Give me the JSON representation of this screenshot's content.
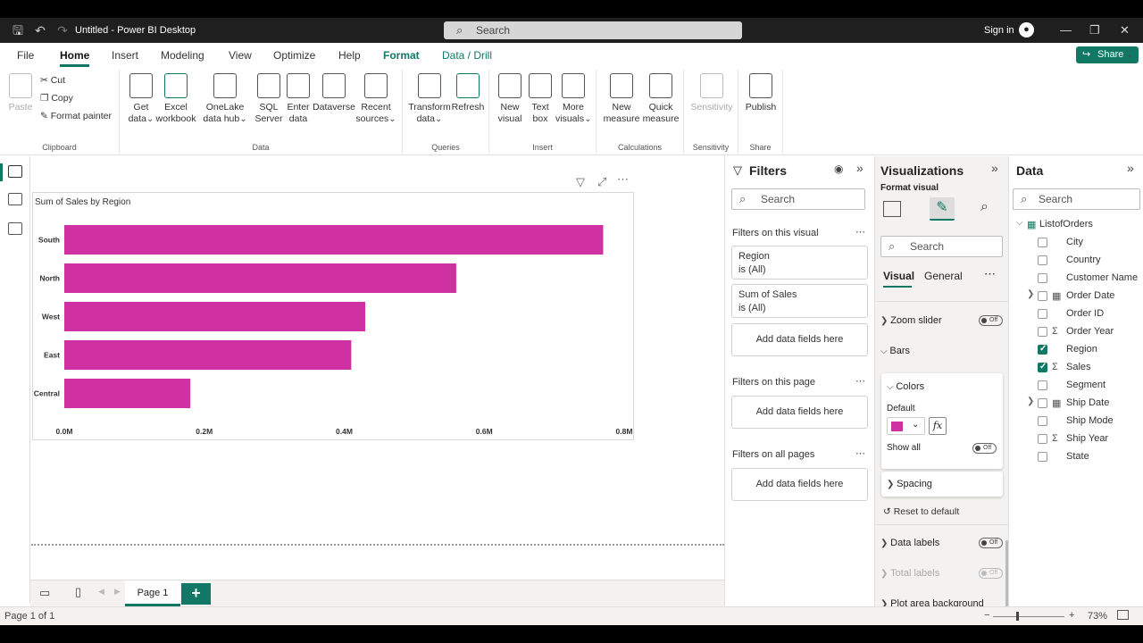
{
  "window": {
    "title": "Untitled - Power BI Desktop",
    "search_placeholder": "Search",
    "sign_in": "Sign in"
  },
  "tabs": [
    "File",
    "Home",
    "Insert",
    "Modeling",
    "View",
    "Optimize",
    "Help",
    "Format",
    "Data / Drill"
  ],
  "share_label": "Share",
  "ribbon": {
    "clipboard": {
      "paste": "Paste",
      "cut": "Cut",
      "copy": "Copy",
      "format_painter": "Format painter",
      "group": "Clipboard"
    },
    "data": {
      "get_data": "Get data",
      "excel": "Excel workbook",
      "onelake": "OneLake data hub",
      "sql": "SQL Server",
      "enter": "Enter data",
      "dataverse": "Dataverse",
      "recent": "Recent sources",
      "group": "Data"
    },
    "queries": {
      "transform": "Transform data",
      "refresh": "Refresh",
      "group": "Queries"
    },
    "insert": {
      "new_visual": "New visual",
      "text_box": "Text box",
      "more_visuals": "More visuals",
      "group": "Insert"
    },
    "calculations": {
      "new_measure": "New measure",
      "quick_measure": "Quick measure",
      "group": "Calculations"
    },
    "sensitivity": {
      "label": "Sensitivity",
      "group": "Sensitivity"
    },
    "share": {
      "publish": "Publish",
      "group": "Share"
    }
  },
  "chart_data": {
    "type": "bar",
    "title": "Sum of Sales by Region",
    "categories": [
      "South",
      "North",
      "West",
      "East",
      "Central"
    ],
    "values": [
      0.77,
      0.56,
      0.43,
      0.41,
      0.18
    ],
    "xlim": [
      0,
      0.8
    ],
    "x_ticks": [
      "0.0M",
      "0.2M",
      "0.4M",
      "0.6M",
      "0.8M"
    ],
    "bar_color": "#d031a2",
    "orientation": "horizontal"
  },
  "filters": {
    "title": "Filters",
    "search": "Search",
    "on_visual": "Filters on this visual",
    "cards": [
      {
        "field": "Region",
        "state": "is (All)"
      },
      {
        "field": "Sum of Sales",
        "state": "is (All)"
      }
    ],
    "add_fields": "Add data fields here",
    "on_page": "Filters on this page",
    "on_all_pages": "Filters on all pages"
  },
  "visualizations": {
    "title": "Visualizations",
    "format_visual": "Format visual",
    "search": "Search",
    "subtabs": [
      "Visual",
      "General"
    ],
    "zoom_slider": "Zoom slider",
    "bars": "Bars",
    "colors": "Colors",
    "default": "Default",
    "show_all": "Show all",
    "spacing": "Spacing",
    "reset": "Reset to default",
    "data_labels": "Data labels",
    "total_labels": "Total labels",
    "plot_area": "Plot area background",
    "toggle_off": "Off",
    "swatch_color": "#d031a2"
  },
  "data_pane": {
    "title": "Data",
    "search": "Search",
    "table": "ListofOrders",
    "fields": [
      {
        "name": "City",
        "checked": false,
        "type": ""
      },
      {
        "name": "Country",
        "checked": false,
        "type": ""
      },
      {
        "name": "Customer Name",
        "checked": false,
        "type": ""
      },
      {
        "name": "Order Date",
        "checked": false,
        "type": "date",
        "expandable": true
      },
      {
        "name": "Order ID",
        "checked": false,
        "type": ""
      },
      {
        "name": "Order Year",
        "checked": false,
        "type": "sum"
      },
      {
        "name": "Region",
        "checked": true,
        "type": ""
      },
      {
        "name": "Sales",
        "checked": true,
        "type": "sum"
      },
      {
        "name": "Segment",
        "checked": false,
        "type": ""
      },
      {
        "name": "Ship Date",
        "checked": false,
        "type": "date",
        "expandable": true
      },
      {
        "name": "Ship Mode",
        "checked": false,
        "type": ""
      },
      {
        "name": "Ship Year",
        "checked": false,
        "type": "sum"
      },
      {
        "name": "State",
        "checked": false,
        "type": ""
      }
    ]
  },
  "pages": {
    "page1": "Page 1",
    "add": "+"
  },
  "status": {
    "page_info": "Page 1 of 1",
    "zoom": "73%"
  }
}
